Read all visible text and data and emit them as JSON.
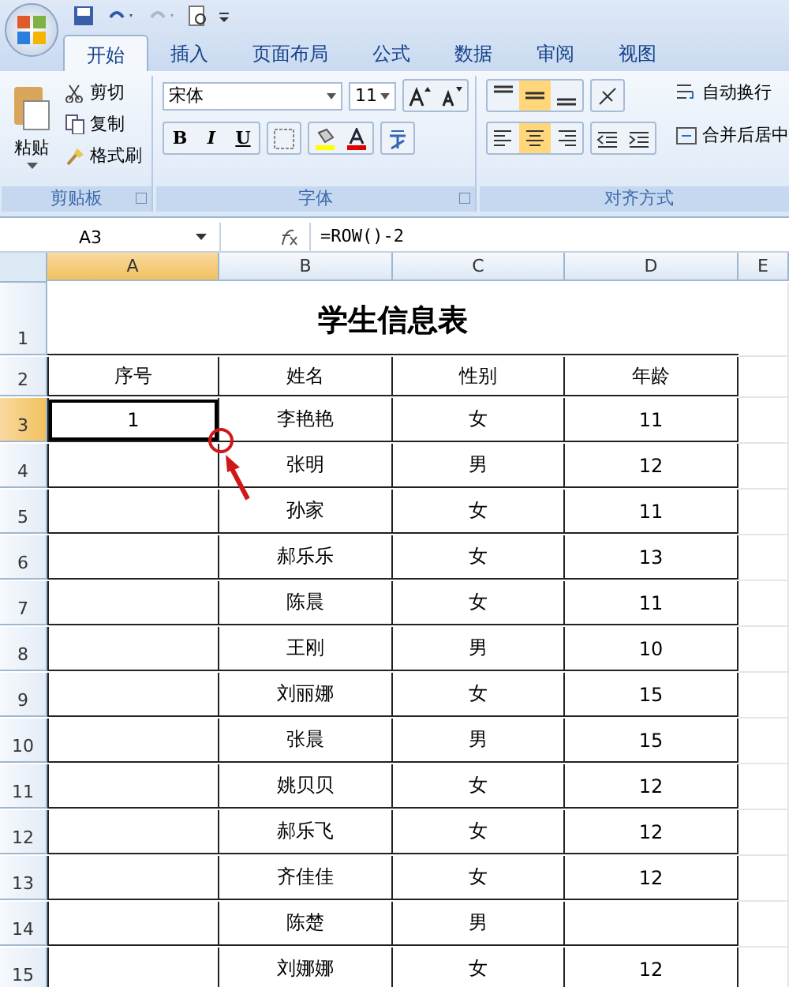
{
  "tabs": [
    {
      "label": "开始",
      "selected": true
    },
    {
      "label": "插入",
      "selected": false
    },
    {
      "label": "页面布局",
      "selected": false
    },
    {
      "label": "公式",
      "selected": false
    },
    {
      "label": "数据",
      "selected": false
    },
    {
      "label": "审阅",
      "selected": false
    },
    {
      "label": "视图",
      "selected": false
    }
  ],
  "clipboard": {
    "title": "剪贴板",
    "paste": "粘贴",
    "buttons": [
      "剪切",
      "复制",
      "格式刷"
    ]
  },
  "font": {
    "title": "字体",
    "font_name": "宋体",
    "font_size": "11",
    "styles": [
      "B",
      "I",
      "U"
    ]
  },
  "alignment": {
    "title": "对齐方式",
    "vertical": [
      {
        "selected": false
      },
      {
        "selected": true
      },
      {
        "selected": false
      }
    ],
    "horizontal": [
      {
        "selected": false
      },
      {
        "selected": true
      },
      {
        "selected": false
      }
    ],
    "buttons": [
      "自动换行",
      "合并后居中"
    ]
  },
  "name_box": "A3",
  "formula": "=ROW()-2",
  "columns": [
    {
      "label": "A",
      "selected": true
    },
    {
      "label": "B",
      "selected": false
    },
    {
      "label": "C",
      "selected": false
    },
    {
      "label": "D",
      "selected": false
    },
    {
      "label": "E",
      "selected": false
    }
  ],
  "rows": [
    {
      "number": "1",
      "selected": false,
      "kind": "title",
      "title": "学生信息表"
    },
    {
      "number": "2",
      "selected": false,
      "kind": "header",
      "a": "序号",
      "b": "姓名",
      "c": "性别",
      "d": "年龄"
    },
    {
      "number": "3",
      "selected": true,
      "kind": "data",
      "a": "1",
      "b": "李艳艳",
      "c": "女",
      "d": "11"
    },
    {
      "number": "4",
      "selected": false,
      "kind": "data",
      "b": "张明",
      "c": "男",
      "d": "12"
    },
    {
      "number": "5",
      "selected": false,
      "kind": "data",
      "b": "孙家",
      "c": "女",
      "d": "11"
    },
    {
      "number": "6",
      "selected": false,
      "kind": "data",
      "b": "郝乐乐",
      "c": "女",
      "d": "13"
    },
    {
      "number": "7",
      "selected": false,
      "kind": "data",
      "b": "陈晨",
      "c": "女",
      "d": "11"
    },
    {
      "number": "8",
      "selected": false,
      "kind": "data",
      "b": "王刚",
      "c": "男",
      "d": "10"
    },
    {
      "number": "9",
      "selected": false,
      "kind": "data",
      "b": "刘丽娜",
      "c": "女",
      "d": "15"
    },
    {
      "number": "10",
      "selected": false,
      "kind": "data",
      "b": "张晨",
      "c": "男",
      "d": "15"
    },
    {
      "number": "11",
      "selected": false,
      "kind": "data",
      "b": "姚贝贝",
      "c": "女",
      "d": "12"
    },
    {
      "number": "12",
      "selected": false,
      "kind": "data",
      "b": "郝乐飞",
      "c": "女",
      "d": "12"
    },
    {
      "number": "13",
      "selected": false,
      "kind": "data",
      "b": "齐佳佳",
      "c": "女",
      "d": "12"
    },
    {
      "number": "14",
      "selected": false,
      "kind": "data",
      "b": "陈楚",
      "c": "男"
    },
    {
      "number": "15",
      "selected": false,
      "kind": "data",
      "b": "刘娜娜",
      "c": "女",
      "d": "12"
    }
  ]
}
